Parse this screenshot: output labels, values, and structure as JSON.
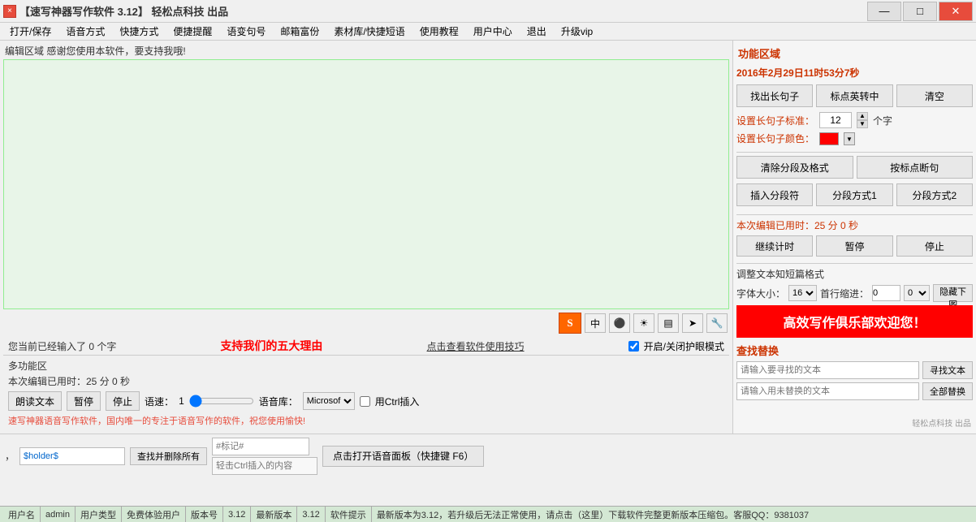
{
  "titleBar": {
    "closeLabel": "×",
    "title": "【速写神器写作软件 3.12】 轻松点科技  出品",
    "minimizeLabel": "—",
    "maximizeLabel": "□",
    "closeBtnLabel": "✕"
  },
  "menuBar": {
    "items": [
      "打开/保存",
      "语音方式",
      "快捷方式",
      "便捷提醒",
      "语变句号",
      "邮箱富份",
      "素材库/快捷短语",
      "使用教程",
      "用户中心",
      "退出",
      "升级vip"
    ]
  },
  "editor": {
    "label": "编辑区域  感谢您使用本软件，要支持我哦!",
    "placeholder": "",
    "toolbarIcons": [
      "S",
      "中",
      "♦",
      "☀",
      "▤",
      "♛",
      "🔧"
    ]
  },
  "bottomInfo": {
    "wordCount": "您当前已经输入了 0 个字",
    "supportText": "支持我们的五大理由",
    "viewTipsText": "点击查看软件使用技巧",
    "eyeMode": "开启/关闭护眼模式"
  },
  "multiFunc": {
    "label": "多功能区",
    "timerText": "本次编辑已用时：25 分 0 秒",
    "readBtnLabel": "朗读文本",
    "pauseBtnLabel": "暂停",
    "stopBtnLabel": "停止",
    "speedLabel": "语速：",
    "speedValue": "1",
    "libLabel": "语音库：",
    "libValue": "Microsof",
    "ctrlCheckLabel": "用Ctrl插入",
    "redText": "速写神器语音写作软件，国内唯一的专注于语音写作的软件，祝您使用愉快!",
    "holderInputValue": "$holder$",
    "holderPlaceholder": "$holder$",
    "tagInputPlaceholder": "#标记#",
    "insertHintText": "轻击Ctrl插入的内容",
    "deleteLabel": "查找并删除所有",
    "openPanelLabel": "点击打开语音面板（快捷键 F6）"
  },
  "rightPanel": {
    "sectionTitle": "功能区域",
    "datetime": "2016年2月29日11时53分7秒",
    "extractLongSentenceLabel": "找出长句子",
    "markEnglishLabel": "标点英转中",
    "clearLabel": "清空",
    "longSentenceStandardLabel": "设置长句子标准：",
    "longSentenceValue": "12",
    "longSentenceUnit": "个字",
    "longSentenceColorLabel": "设置长句子颜色：",
    "clearParagraphLabel": "清除分段及格式",
    "markPunctuationLabel": "按标点断句",
    "insertParagraphLabel": "插入分段符",
    "paragraphMode1Label": "分段方式1",
    "paragraphMode2Label": "分段方式2",
    "timerLabel": "本次编辑已用时：25 分 0 秒",
    "continueTimerLabel": "继续计时",
    "pauseTimerLabel": "暂停",
    "stopTimerLabel": "停止",
    "formatTitle": "调整文本知短篇格式",
    "fontSizeLabel": "字体大小：",
    "fontSizeValue": "16",
    "indentLabel": "首行缩进：",
    "indentValue": "0",
    "hideDownLabel": "隐藏下图",
    "bannerText": "高效写作俱乐部欢迎您！",
    "searchTitle": "查找替换",
    "searchPlaceholder": "请输入要寻找的文本",
    "searchBtnLabel": "寻找文本",
    "replacePlaceholder": "请输入用未替换的文本",
    "replaceAllLabel": "全部替换",
    "watermarkLabel": "轻松点科技 出品"
  },
  "statusBar": {
    "userNameLabel": "用户名",
    "userNameValue": "admin",
    "userTypeLabel": "用户类型",
    "userTypeValue": "免费体验用户",
    "versionLabel": "版本号",
    "versionValue": "3.12",
    "latestVersionLabel": "最新版本",
    "latestVersionValue": "3.12",
    "softwareTipLabel": "软件提示",
    "softwareTipValue": "最新版本为3.12，若升级后无法正常使用，请点击（这里）下载软件完整更新版本压缩包。客服QQ：9381037"
  }
}
